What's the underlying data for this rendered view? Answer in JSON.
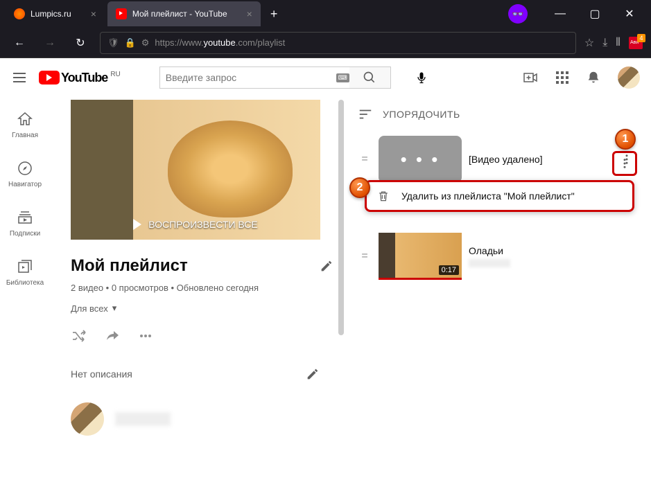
{
  "browser": {
    "tabs": [
      {
        "title": "Lumpics.ru",
        "active": false
      },
      {
        "title": "Мой плейлист - YouTube",
        "active": true
      }
    ],
    "url_prefix": "https://www.",
    "url_domain": "youtube",
    "url_suffix": ".com/playlist",
    "ext_badge": "4"
  },
  "youtube": {
    "logo_text": "YouTube",
    "logo_region": "RU",
    "search_placeholder": "Введите запрос",
    "sidebar": [
      {
        "label": "Главная"
      },
      {
        "label": "Навигатор"
      },
      {
        "label": "Подписки"
      },
      {
        "label": "Библиотека"
      }
    ]
  },
  "playlist": {
    "play_all": "ВОСПРОИЗВЕСТИ ВСЕ",
    "title": "Мой плейлист",
    "meta": "2 видео • 0 просмотров • Обновлено сегодня",
    "privacy": "Для всех",
    "description": "Нет описания"
  },
  "right": {
    "sort_label": "УПОРЯДОЧИТЬ",
    "items": [
      {
        "title": "[Видео удалено]",
        "deleted": true,
        "duration": ""
      },
      {
        "title": "Оладьи",
        "deleted": false,
        "duration": "0:17"
      }
    ],
    "context_menu_label": "Удалить из плейлиста \"Мой плейлист\""
  },
  "callouts": {
    "one": "1",
    "two": "2"
  }
}
